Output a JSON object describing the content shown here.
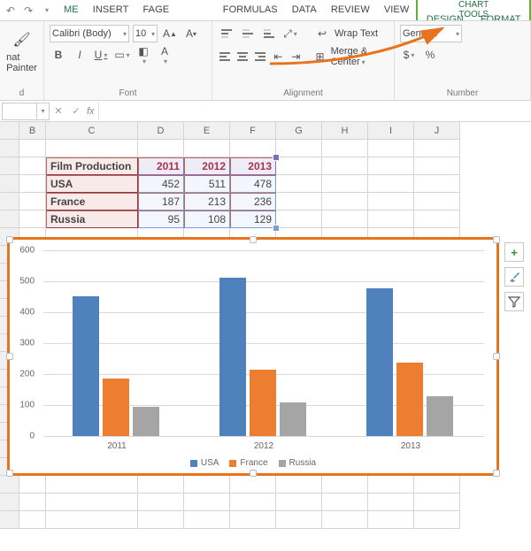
{
  "qat": {
    "undo": "↶",
    "redo": "↷"
  },
  "tabs": [
    "ME",
    "INSERT",
    "FAGE LAYOUT",
    "FORMULAS",
    "DATA",
    "REVIEW",
    "VIEW"
  ],
  "chart_tools": {
    "header": "CHART TOOLS",
    "items": [
      "DESIGN",
      "FORMAT"
    ]
  },
  "ribbon": {
    "clipboard": {
      "painter": "nat Painter",
      "group_label": "d"
    },
    "font": {
      "name": "Calibri (Body)",
      "size": "10",
      "group_label": "Font",
      "bold": "B",
      "italic": "I",
      "underline": "U"
    },
    "alignment": {
      "wrap": "Wrap Text",
      "merge": "Merge & Center",
      "group_label": "Alignment"
    },
    "number": {
      "format": "General",
      "group_label": "Number",
      "currency": "$",
      "percent": "%"
    }
  },
  "fxbar": {
    "name": "",
    "fx": "fx",
    "cancel": "✕",
    "enter": "✓"
  },
  "columns": [
    "B",
    "C",
    "D",
    "E",
    "F",
    "G",
    "H",
    "I",
    "J"
  ],
  "col_widths": {
    "B": 30,
    "C": 104,
    "D": 52,
    "E": 52,
    "F": 52,
    "G": 52,
    "H": 52,
    "I": 52,
    "J": 52
  },
  "table": {
    "title": "Film Production",
    "years": [
      "2011",
      "2012",
      "2013"
    ],
    "rows": [
      {
        "label": "USA",
        "vals": [
          "452",
          "511",
          "478"
        ]
      },
      {
        "label": "France",
        "vals": [
          "187",
          "213",
          "236"
        ]
      },
      {
        "label": "Russia",
        "vals": [
          "95",
          "108",
          "129"
        ]
      }
    ]
  },
  "chart_data": {
    "type": "bar",
    "categories": [
      "2011",
      "2012",
      "2013"
    ],
    "series": [
      {
        "name": "USA",
        "values": [
          452,
          511,
          478
        ],
        "color": "#4f81bd"
      },
      {
        "name": "France",
        "values": [
          187,
          213,
          236
        ],
        "color": "#ed7d31"
      },
      {
        "name": "Russia",
        "values": [
          95,
          108,
          129
        ],
        "color": "#a5a5a5"
      }
    ],
    "ylim": [
      0,
      600
    ],
    "y_ticks": [
      0,
      100,
      200,
      300,
      400,
      500,
      600
    ],
    "xlabel": "",
    "ylabel": "",
    "title": ""
  },
  "side_buttons": {
    "plus": "+",
    "brush": "✎",
    "filter": "⛉"
  }
}
